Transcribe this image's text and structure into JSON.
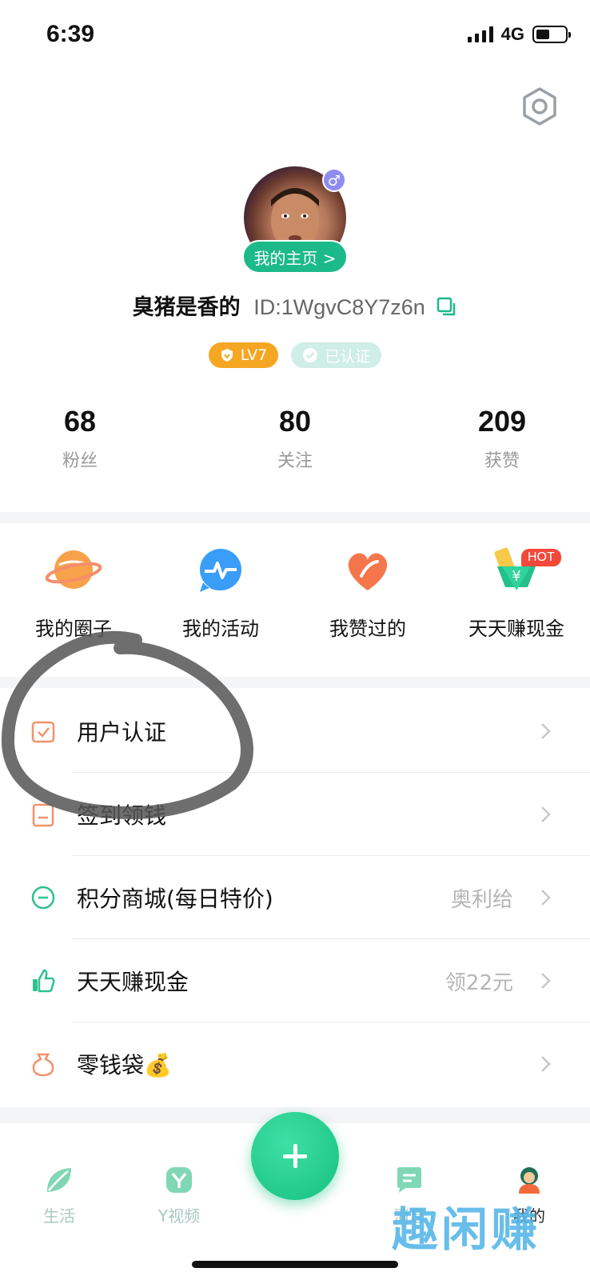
{
  "status": {
    "time": "6:39",
    "network": "4G"
  },
  "profile": {
    "home_button": "我的主页 >",
    "gender_symbol": "♂",
    "username": "臭猪是香的",
    "user_id": "ID:1WgvC8Y7z6n",
    "level_badge": "LV7",
    "verified_badge": "已认证"
  },
  "stats": [
    {
      "value": "68",
      "label": "粉丝"
    },
    {
      "value": "80",
      "label": "关注"
    },
    {
      "value": "209",
      "label": "获赞"
    }
  ],
  "shortcuts": [
    {
      "label": "我的圈子",
      "icon": "planet-icon"
    },
    {
      "label": "我的活动",
      "icon": "activity-icon"
    },
    {
      "label": "我赞过的",
      "icon": "heart-icon"
    },
    {
      "label": "天天赚现金",
      "icon": "cash-icon",
      "badge": "HOT"
    }
  ],
  "menu": [
    {
      "label": "用户认证",
      "extra": "",
      "icon": "verify-check-icon"
    },
    {
      "label": "签到领钱",
      "extra": "",
      "icon": "calendar-icon"
    },
    {
      "label": "积分商城(每日特价)",
      "extra": "奥利给",
      "icon": "points-icon"
    },
    {
      "label": "天天赚现金",
      "extra": "领22元",
      "icon": "thumbs-up-icon"
    },
    {
      "label": "零钱袋💰",
      "extra": "",
      "icon": "wallet-bag-icon"
    }
  ],
  "tabbar": [
    {
      "label": "生活",
      "icon": "leaf-icon"
    },
    {
      "label": "Y视频",
      "icon": "video-icon"
    },
    {
      "label": "消息",
      "icon": "message-icon"
    },
    {
      "label": "我的",
      "icon": "profile-icon"
    }
  ],
  "watermark": "趣闲赚",
  "colors": {
    "accent": "#1cb98a",
    "level": "#f5a623",
    "hot": "#f2493a"
  }
}
